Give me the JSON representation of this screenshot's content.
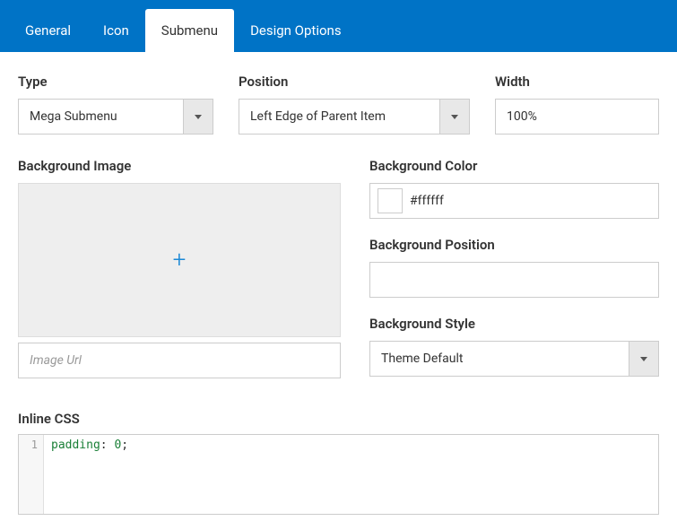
{
  "tabs": {
    "general": "General",
    "icon": "Icon",
    "submenu": "Submenu",
    "design_options": "Design Options",
    "active": "submenu"
  },
  "labels": {
    "type": "Type",
    "position": "Position",
    "width": "Width",
    "bg_image": "Background Image",
    "bg_color": "Background Color",
    "bg_position": "Background Position",
    "bg_style": "Background Style",
    "inline_css": "Inline CSS",
    "image_url_placeholder": "Image Url"
  },
  "values": {
    "type": "Mega Submenu",
    "position": "Left Edge of Parent Item",
    "width": "100%",
    "bg_color": "#ffffff",
    "bg_position": "",
    "bg_style": "Theme Default"
  },
  "css": {
    "line_no": "1",
    "prop": "padding",
    "val": "0"
  }
}
